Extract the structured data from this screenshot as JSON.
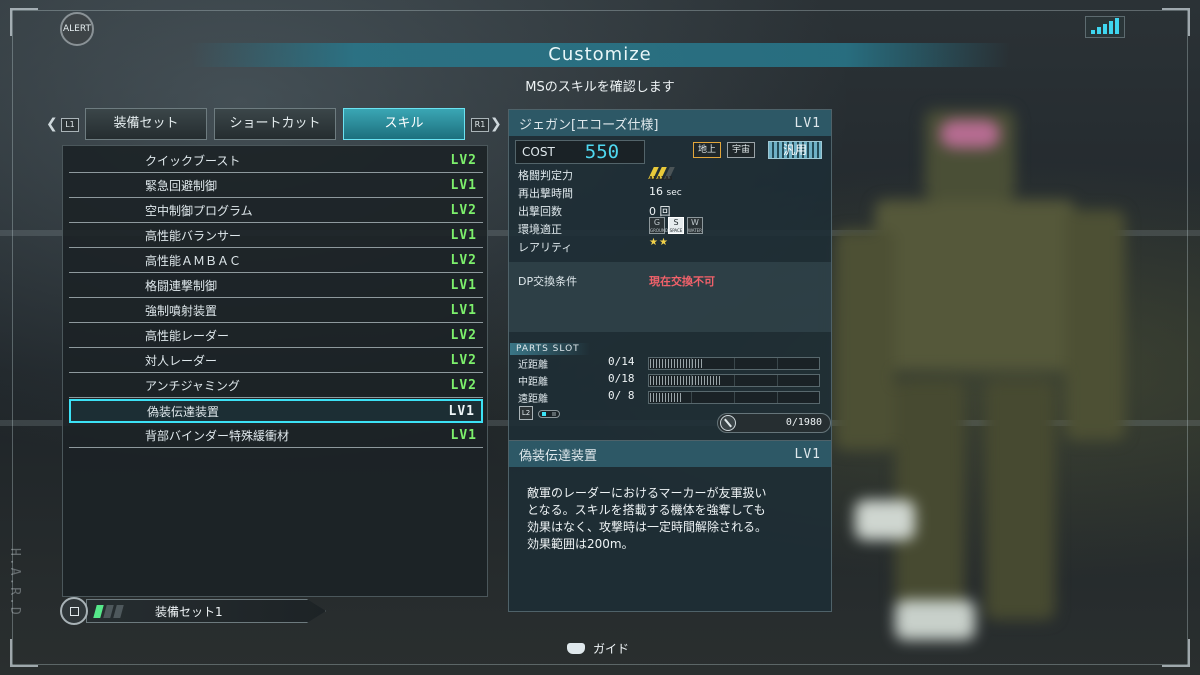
{
  "header": {
    "alert_label": "ALERT",
    "title": "Customize",
    "subtitle": "MSのスキルを確認します",
    "side_label": "H.A.R.D"
  },
  "tabs": {
    "left_key": "L1",
    "right_key": "R1",
    "items": [
      {
        "label": "装備セット",
        "active": false
      },
      {
        "label": "ショートカット",
        "active": false
      },
      {
        "label": "スキル",
        "active": true
      }
    ]
  },
  "skills": [
    {
      "name": "クイックブースト",
      "level": "LV2"
    },
    {
      "name": "緊急回避制御",
      "level": "LV1"
    },
    {
      "name": "空中制御プログラム",
      "level": "LV2"
    },
    {
      "name": "高性能バランサー",
      "level": "LV1"
    },
    {
      "name": "高性能ＡＭＢＡＣ",
      "level": "LV2"
    },
    {
      "name": "格闘連撃制御",
      "level": "LV1"
    },
    {
      "name": "強制噴射装置",
      "level": "LV1"
    },
    {
      "name": "高性能レーダー",
      "level": "LV2"
    },
    {
      "name": "対人レーダー",
      "level": "LV2"
    },
    {
      "name": "アンチジャミング",
      "level": "LV2"
    },
    {
      "name": "偽装伝達装置",
      "level": "LV1",
      "selected": true
    },
    {
      "name": "背部バインダー特殊緩衝材",
      "level": "LV1"
    }
  ],
  "loadout": {
    "label": "装備セット1",
    "bars_total": 3,
    "bars_active": 1
  },
  "unit": {
    "name": "ジェガン[エコーズ仕様]",
    "level": "LV1",
    "cost_label": "COST",
    "cost": "550",
    "env_tags": [
      "地上",
      "宇宙"
    ],
    "type_tag": "汎用",
    "stats": {
      "melee_label": "格闘判定力",
      "melee_icon": "melee-rank-icon",
      "melee_marks": [
        "A1",
        "A2",
        "A3"
      ],
      "melee_level": 2,
      "respawn_label": "再出撃時間",
      "respawn_value": "16",
      "respawn_unit": "sec",
      "sorties_label": "出撃回数",
      "sorties_value": "0 回",
      "env_label": "環境適正",
      "env_boxes": [
        {
          "letter": "G",
          "sub": "GROUND",
          "on": false
        },
        {
          "letter": "S",
          "sub": "SPACE",
          "on": true
        },
        {
          "letter": "W",
          "sub": "WATER",
          "on": false
        }
      ],
      "rarity_label": "レアリティ",
      "rarity_stars": "★★"
    },
    "dp_label": "DP交換条件",
    "dp_value": "現在交換不可",
    "parts_slot_title": "PARTS SLOT",
    "parts_slots": [
      {
        "name": "近距離",
        "count": "0/14",
        "capacity": 14
      },
      {
        "name": "中距離",
        "count": "0/18",
        "capacity": 18
      },
      {
        "name": "遠距離",
        "count": "0/ 8",
        "capacity": 8
      }
    ],
    "l2_key": "L2",
    "points": "0/1980"
  },
  "detail": {
    "name": "偽装伝達装置",
    "level": "LV1",
    "lines": [
      "敵軍のレーダーにおけるマーカーが友軍扱い",
      "となる。スキルを搭載する機体を強奪しても",
      "効果はなく、攻撃時は一定時間解除される。",
      "効果範囲は200m。"
    ]
  },
  "footer": {
    "guide_label": "ガイド",
    "guide_icon": "touchpad-icon"
  },
  "colors": {
    "accent": "#3ce2f6",
    "level_green": "#7df06c",
    "cost_blue": "#4fd8f0",
    "warning_red": "#f1616a",
    "header_teal": "#2d5866"
  }
}
